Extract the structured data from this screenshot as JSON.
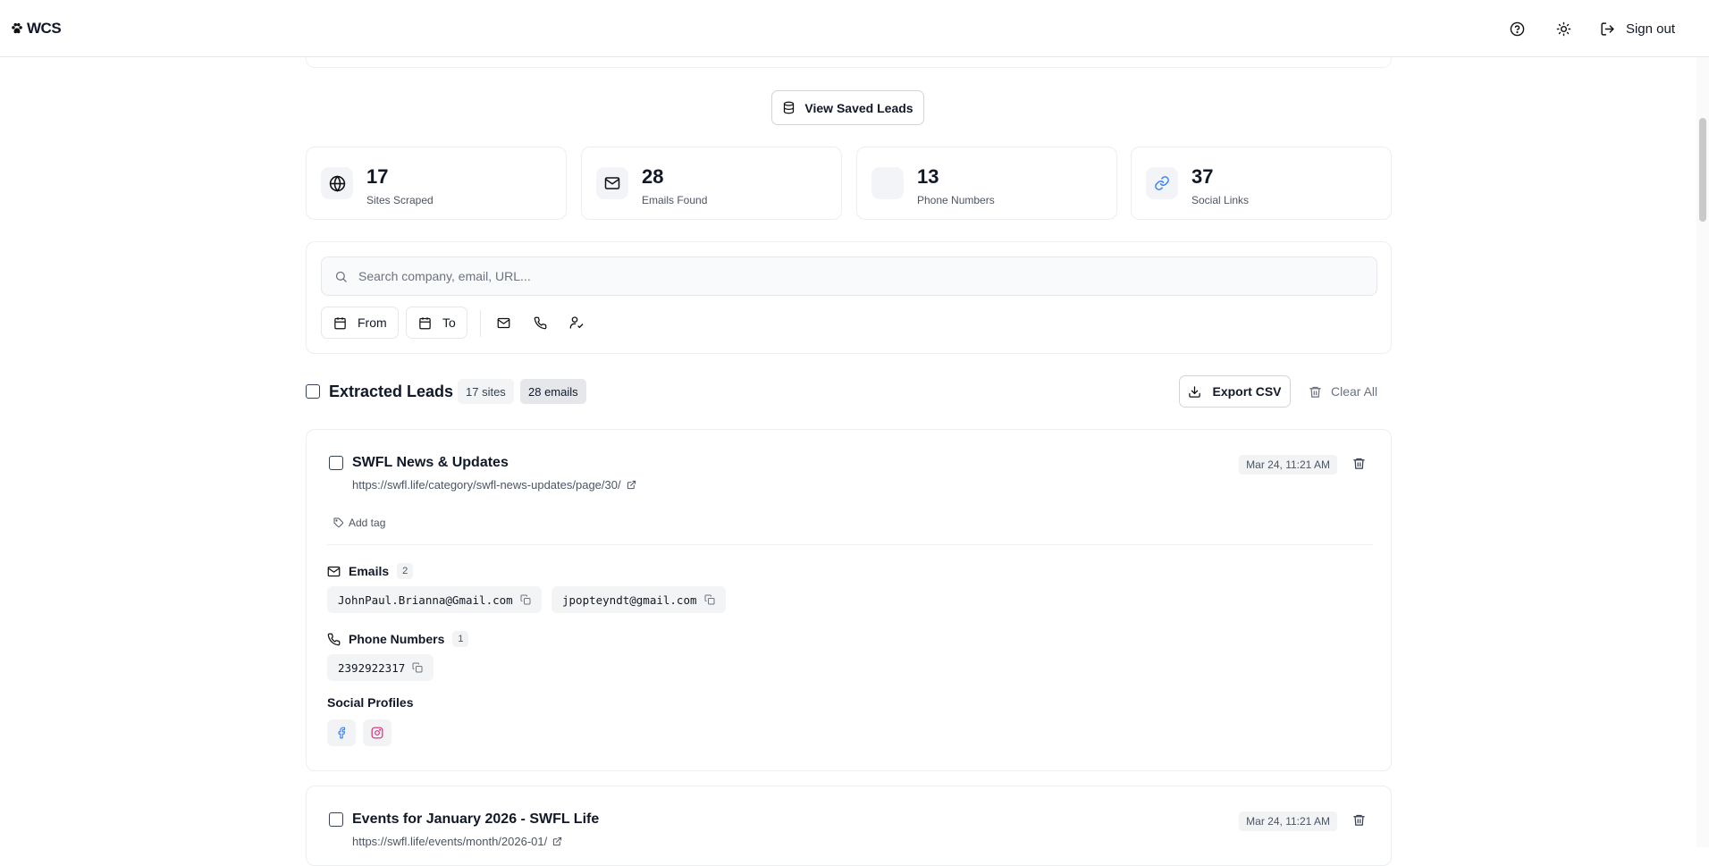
{
  "header": {
    "logo_text": "WCS",
    "help_icon": "help-circle-icon",
    "theme_icon": "sun-icon",
    "signout_label": "Sign out"
  },
  "saved_leads_label": "View Saved Leads",
  "stats": [
    {
      "value": "17",
      "label": "Sites Scraped",
      "icon": "globe-icon"
    },
    {
      "value": "28",
      "label": "Emails Found",
      "icon": "mail-icon"
    },
    {
      "value": "13",
      "label": "Phone Numbers",
      "icon": "none"
    },
    {
      "value": "37",
      "label": "Social Links",
      "icon": "link-icon"
    }
  ],
  "filters": {
    "search_placeholder": "Search company, email, URL...",
    "search_value": "",
    "from_label": "From",
    "to_label": "To"
  },
  "leads_section": {
    "title": "Extracted Leads",
    "badge_sites": "17 sites",
    "badge_emails": "28 emails",
    "export_label": "Export CSV",
    "clear_label": "Clear All"
  },
  "leads": [
    {
      "title": "SWFL News & Updates",
      "url": "https://swfl.life/category/swfl-news-updates/page/30/",
      "date": "Mar 24, 11:21 AM",
      "tag_label": "Add tag",
      "emails_label": "Emails",
      "emails_count": "2",
      "emails": [
        "JohnPaul.Brianna@Gmail.com",
        "jpopteyndt@gmail.com"
      ],
      "phones_label": "Phone Numbers",
      "phones_count": "1",
      "phones": [
        "2392922317"
      ],
      "social_label": "Social Profiles",
      "social": [
        "facebook-icon",
        "instagram-icon"
      ]
    },
    {
      "title": "Events for January 2026 - SWFL Life",
      "url": "https://swfl.life/events/month/2026-01/",
      "date": "Mar 24, 11:21 AM"
    }
  ],
  "colors": {
    "facebook": "#3b82f6",
    "instagram": "#db2777",
    "link": "#3b82f6",
    "border": "#eceef1"
  }
}
